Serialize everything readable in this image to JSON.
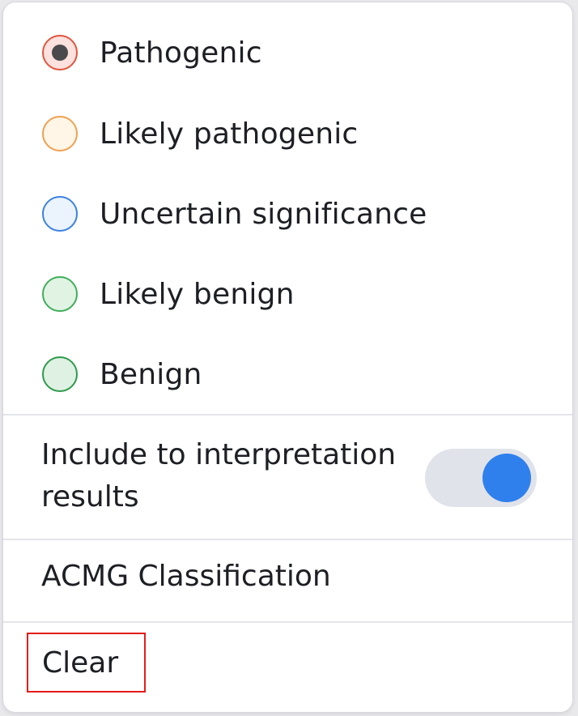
{
  "classification_options": [
    {
      "label": "Pathogenic",
      "selected": true,
      "border": "#e0553c",
      "fill": "#fde1de"
    },
    {
      "label": "Likely pathogenic",
      "selected": false,
      "border": "#f0a050",
      "fill": "#fff6e8"
    },
    {
      "label": "Uncertain significance",
      "selected": false,
      "border": "#3b82e0",
      "fill": "#ebf3fd"
    },
    {
      "label": "Likely benign",
      "selected": false,
      "border": "#3fae5a",
      "fill": "#e1f4e4"
    },
    {
      "label": "Benign",
      "selected": false,
      "border": "#2e9a4c",
      "fill": "#dff1e2"
    }
  ],
  "include_toggle": {
    "label": "Include to interpretation results",
    "on": true,
    "accent": "#2f80ed"
  },
  "acmg_section": {
    "label": "ACMG Classification"
  },
  "clear_button": {
    "label": "Clear",
    "highlight": "#e31b1b"
  }
}
